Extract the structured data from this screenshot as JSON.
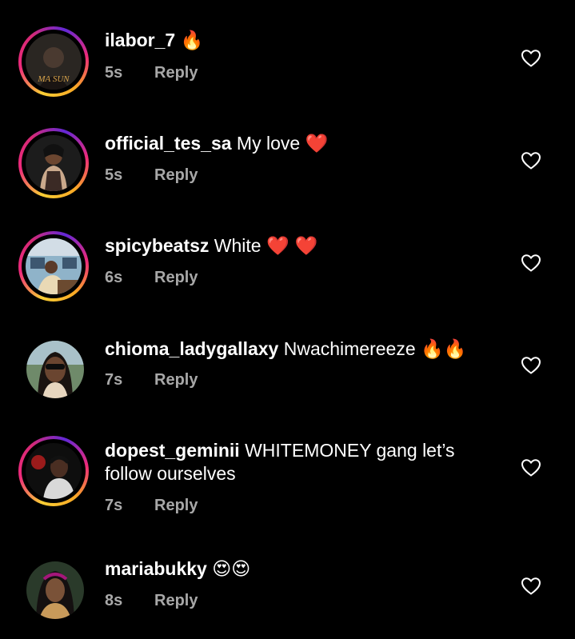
{
  "comments": [
    {
      "username": "ilabor_7",
      "text": "",
      "emoji": "🔥",
      "time": "5s",
      "reply_label": "Reply",
      "avatar_text": "MA SUN",
      "story_ring": true
    },
    {
      "username": "official_tes_sa",
      "text": "My love",
      "emoji": "❤️",
      "time": "5s",
      "reply_label": "Reply",
      "story_ring": true
    },
    {
      "username": "spicybeatsz",
      "text": "White",
      "emoji": "❤️ ❤️",
      "time": "6s",
      "reply_label": "Reply",
      "story_ring": true
    },
    {
      "username": "chioma_ladygallaxy",
      "text": "Nwachimereeze",
      "emoji": "🔥🔥",
      "time": "7s",
      "reply_label": "Reply",
      "story_ring": false
    },
    {
      "username": "dopest_geminii",
      "text": "WHITEMONEY gang let’s",
      "text_line2": "follow ourselves",
      "emoji": "",
      "time": "7s",
      "reply_label": "Reply",
      "story_ring": true
    },
    {
      "username": "mariabukky",
      "text": "",
      "emoji": "😍😍",
      "time": "8s",
      "reply_label": "Reply",
      "story_ring": false
    }
  ],
  "colors": {
    "background": "#000000",
    "text": "#ffffff",
    "meta": "#a8a8a8",
    "heart_outline": "#ffffff"
  },
  "icons": {
    "like": "heart-outline-icon"
  }
}
